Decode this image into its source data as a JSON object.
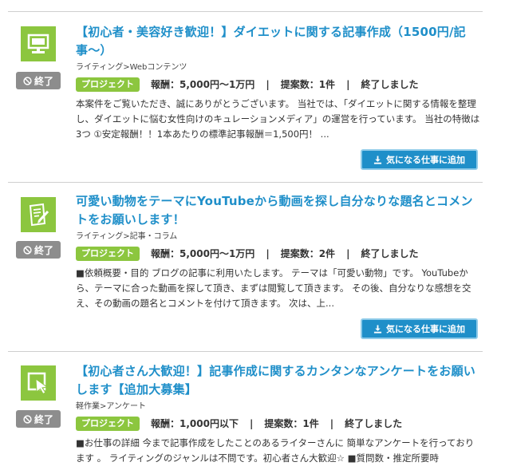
{
  "jobs": [
    {
      "icon": "desktop-monitor-icon",
      "status": "終了",
      "title": "【初心者・美容好き歓迎！】ダイエットに関する記事作成（1500円/記事〜）",
      "category": "ライティング>Webコンテンツ",
      "type_tag": "プロジェクト",
      "reward": "報酬：5,000円〜1万円",
      "proposals": "提案数：1件",
      "state": "終了しました",
      "description": "本案件をご覧いただき、誠にありがとうございます。 当社では、「ダイエットに関する情報を整理し、ダイエットに悩む女性向けのキュレーションメディア」の運営を行っています。 当社の特徴は3つ ①安定報酬！！1本あたりの標準記事報酬＝1,500円！ ...",
      "fav_label": "気になる仕事に追加"
    },
    {
      "icon": "document-pen-icon",
      "status": "終了",
      "title": "可愛い動物をテーマにYouTubeから動画を探し自分なりな題名とコメントをお願いします！",
      "category": "ライティング>記事・コラム",
      "type_tag": "プロジェクト",
      "reward": "報酬：5,000円〜1万円",
      "proposals": "提案数：2件",
      "state": "終了しました",
      "description": "■依頼概要・目的 ブログの記事に利用いたします。 テーマは「可愛い動物」です。 YouTubeから、テーマに合った動画を探して頂き、まずは閲覧して頂きます。 その後、自分なりな感想を交え、その動画の題名とコメントを付けて頂きます。 次は、上...",
      "fav_label": "気になる仕事に追加"
    },
    {
      "icon": "cursor-click-icon",
      "status": "終了",
      "title": "【初心者さん大歓迎！】記事作成に関するカンタンなアンケートをお願いします【追加大募集】",
      "category": "軽作業>アンケート",
      "type_tag": "プロジェクト",
      "reward": "報酬：1,000円以下",
      "proposals": "提案数：1件",
      "state": "終了しました",
      "description": "■お仕事の詳細 今まで記事作成をしたことのあるライターさんに 簡単なアンケートを行っております 。 ライティングのジャンルは不問です。初心者さん大歓迎☆ ■質問数・推定所要時",
      "fav_label": ""
    }
  ],
  "colors": {
    "accent_blue": "#1f8fc9",
    "accent_green": "#8cc63f",
    "badge_gray": "#8d8d8d"
  }
}
